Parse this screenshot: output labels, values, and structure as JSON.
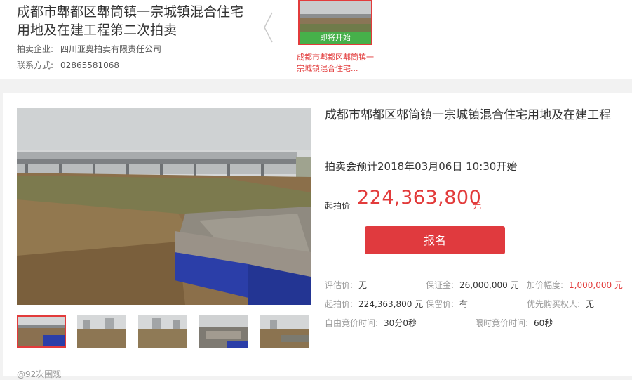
{
  "top": {
    "title": "成都市郫都区郫筒镇一宗城镇混合住宅用地及在建工程第二次拍卖",
    "company_label": "拍卖企业:",
    "company": "四川亚奥拍卖有限责任公司",
    "contact_label": "联系方式:",
    "contact": "02865581068",
    "thumb_badge": "即将开始",
    "thumb_caption": "成都市郫都区郫筒镇一宗城镇混合住宅..."
  },
  "detail": {
    "title": "成都市郫都区郫筒镇一宗城镇混合住宅用地及在建工程",
    "auction_time": "拍卖会预计2018年03月06日 10:30开始",
    "start_price_label": "起拍价",
    "start_price": "224,363,800",
    "start_price_unit": "元",
    "signup_label": "报名"
  },
  "info": {
    "appraisal_label": "评估价:",
    "appraisal": "无",
    "deposit_label": "保证金:",
    "deposit": "26,000,000 元",
    "increment_label": "加价幅度:",
    "increment": "1,000,000 元",
    "start_label": "起拍价:",
    "start": "224,363,800 元",
    "reserve_label": "保留价:",
    "reserve": "有",
    "priority_label": "优先购买权人:",
    "priority": "无",
    "free_bid_label": "自由竞价时间:",
    "free_bid": "30分0秒",
    "timed_bid_label": "限时竞价时间:",
    "timed_bid": "60秒"
  },
  "views": "@92次围观",
  "colors": {
    "accent": "#e23b3b",
    "badge": "#46b04a",
    "button": "#e03a3e"
  }
}
